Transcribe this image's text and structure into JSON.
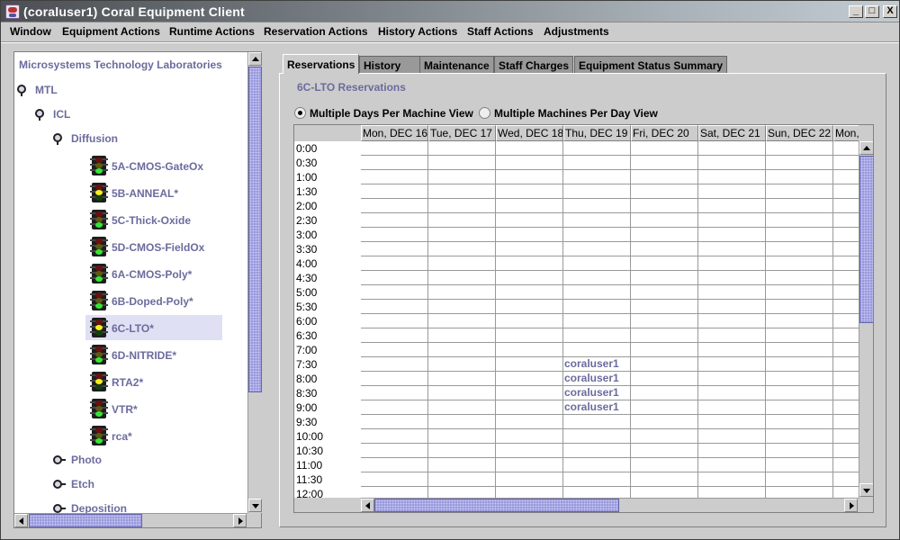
{
  "window": {
    "title": "(coraluser1) Coral Equipment Client",
    "controls": {
      "minimize": "_",
      "maximize": "□",
      "close": "X"
    }
  },
  "menubar": [
    "Window",
    "Equipment Actions",
    "Runtime Actions",
    "Reservation Actions",
    "History Actions",
    "Staff Actions",
    "Adjustments"
  ],
  "tree": {
    "root_label": "Microsystems Technology Laboratories",
    "nodes": [
      {
        "label": "MTL",
        "kind": "folder-open",
        "depth": 0
      },
      {
        "label": "ICL",
        "kind": "folder-open",
        "depth": 1
      },
      {
        "label": "Diffusion",
        "kind": "folder-open",
        "depth": 2
      },
      {
        "label": "5A-CMOS-GateOx",
        "kind": "equipment",
        "status": "green"
      },
      {
        "label": "5B-ANNEAL*",
        "kind": "equipment",
        "status": "yellow"
      },
      {
        "label": "5C-Thick-Oxide",
        "kind": "equipment",
        "status": "green"
      },
      {
        "label": "5D-CMOS-FieldOx",
        "kind": "equipment",
        "status": "green"
      },
      {
        "label": "6A-CMOS-Poly*",
        "kind": "equipment",
        "status": "green"
      },
      {
        "label": "6B-Doped-Poly*",
        "kind": "equipment",
        "status": "green"
      },
      {
        "label": "6C-LTO*",
        "kind": "equipment",
        "status": "yellow",
        "selected": true
      },
      {
        "label": "6D-NITRIDE*",
        "kind": "equipment",
        "status": "green"
      },
      {
        "label": "RTA2*",
        "kind": "equipment",
        "status": "yellow"
      },
      {
        "label": "VTR*",
        "kind": "equipment",
        "status": "green"
      },
      {
        "label": "rca*",
        "kind": "equipment",
        "status": "green"
      },
      {
        "label": "Photo",
        "kind": "folder-closed",
        "depth": 2
      },
      {
        "label": "Etch",
        "kind": "folder-closed",
        "depth": 2
      },
      {
        "label": "Deposition",
        "kind": "folder-closed",
        "depth": 2
      }
    ]
  },
  "tabs": [
    {
      "label": "Reservations",
      "active": true
    },
    {
      "label": "History"
    },
    {
      "label": "Maintenance"
    },
    {
      "label": "Staff Charges"
    },
    {
      "label": "Equipment Status Summary"
    }
  ],
  "reservations": {
    "title": "6C-LTO Reservations",
    "view_options": [
      {
        "label": "Multiple Days Per Machine View",
        "selected": true
      },
      {
        "label": "Multiple Machines Per Day View",
        "selected": false
      }
    ],
    "columns": [
      "Mon, DEC 16",
      "Tue, DEC 17",
      "Wed, DEC 18",
      "Thu, DEC 19",
      "Fri, DEC 20",
      "Sat, DEC 21",
      "Sun, DEC 22",
      "Mon,"
    ],
    "times": [
      "0:00",
      "0:30",
      "1:00",
      "1:30",
      "2:00",
      "2:30",
      "3:00",
      "3:30",
      "4:00",
      "4:30",
      "5:00",
      "5:30",
      "6:00",
      "6:30",
      "7:00",
      "7:30",
      "8:00",
      "8:30",
      "9:00",
      "9:30",
      "10:00",
      "10:30",
      "11:00",
      "11:30",
      "12:00"
    ],
    "bookings": [
      {
        "column": "Thu, DEC 19",
        "time": "7:30",
        "user": "coraluser1"
      },
      {
        "column": "Thu, DEC 19",
        "time": "8:00",
        "user": "coraluser1"
      },
      {
        "column": "Thu, DEC 19",
        "time": "8:30",
        "user": "coraluser1"
      },
      {
        "column": "Thu, DEC 19",
        "time": "9:00",
        "user": "coraluser1"
      }
    ]
  },
  "colors": {
    "accent_text": "#6b6b9e",
    "scroll_thumb": "#9999dd",
    "selection_bg": "#e0e0f4",
    "status_green": "#33e633",
    "status_yellow": "#f4f01a"
  }
}
